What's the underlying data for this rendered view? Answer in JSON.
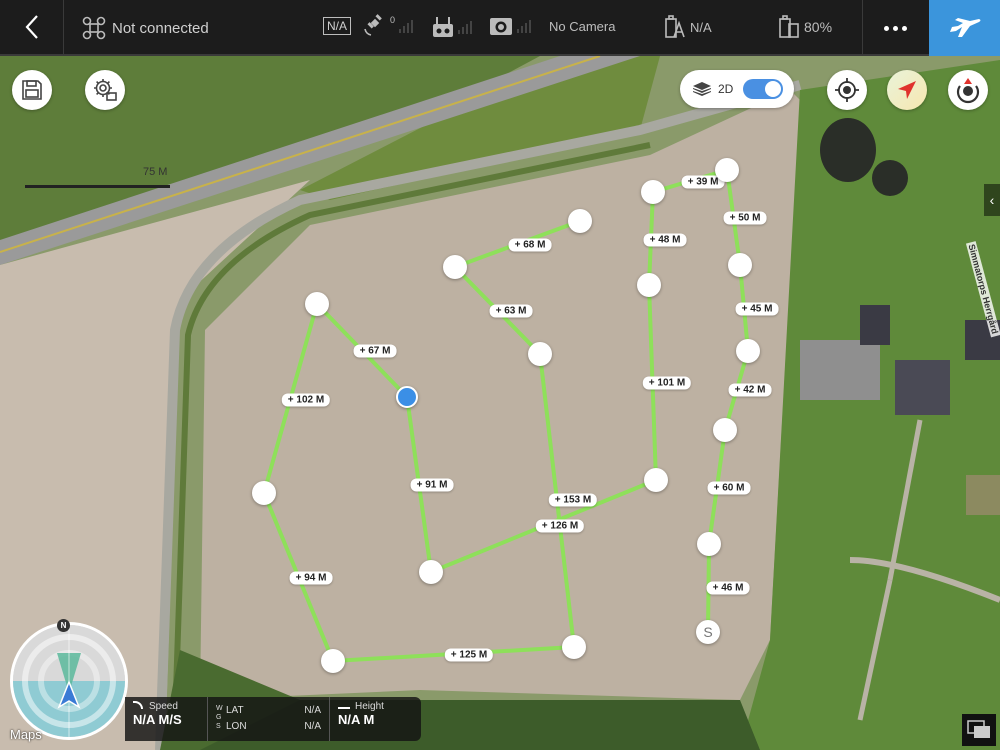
{
  "topbar": {
    "back_icon": "chevron-left-icon",
    "connection_status": "Not connected",
    "flight_mode": "N/A",
    "gps_count": "0",
    "camera_status": "No Camera",
    "aircraft_battery": "N/A",
    "device_battery": "80%",
    "more_icon": "ellipsis-icon",
    "fly_icon": "airplane-icon"
  },
  "map": {
    "scale_label": "75 M",
    "view_mode_label": "2D",
    "view_mode_toggle_on": true,
    "street_label": "Simmatorps Herrgård",
    "attribution": "Maps",
    "colors": {
      "path": "#8ee05a",
      "active_waypoint": "#3b8fe6",
      "fly_button": "#3b95dc"
    }
  },
  "waypoints": [
    {
      "id": "S",
      "label": "S"
    },
    {
      "id": "2",
      "label": ""
    },
    {
      "id": "3",
      "label": ""
    },
    {
      "id": "4",
      "label": ""
    },
    {
      "id": "5",
      "label": ""
    },
    {
      "id": "6",
      "label": ""
    },
    {
      "id": "7",
      "label": ""
    },
    {
      "id": "8",
      "label": ""
    },
    {
      "id": "9",
      "label": ""
    },
    {
      "id": "10",
      "label": ""
    },
    {
      "id": "11",
      "label": "",
      "active": true
    },
    {
      "id": "12",
      "label": ""
    },
    {
      "id": "13",
      "label": ""
    },
    {
      "id": "14",
      "label": ""
    },
    {
      "id": "15",
      "label": ""
    },
    {
      "id": "16",
      "label": ""
    },
    {
      "id": "17",
      "label": ""
    },
    {
      "id": "18",
      "label": ""
    }
  ],
  "segments": [
    "+ 46 M",
    "+ 60 M",
    "+ 42 M",
    "+ 45 M",
    "+ 50 M",
    "+ 39 M",
    "+ 48 M",
    "+ 101 M",
    "+ 126 M",
    "+ 91 M",
    "+ 67 M",
    "+ 102 M",
    "+ 94 M",
    "+ 125 M",
    "+ 153 M",
    "+ 63 M",
    "+ 68 M"
  ],
  "telemetry": {
    "speed_label": "Speed",
    "speed_value": "N/A M/S",
    "coord_system": "WGS",
    "lat_label": "LAT",
    "lat_value": "N/A",
    "lon_label": "LON",
    "lon_value": "N/A",
    "height_label": "Height",
    "height_value": "N/A M"
  },
  "compass": {
    "north_label": "N"
  }
}
